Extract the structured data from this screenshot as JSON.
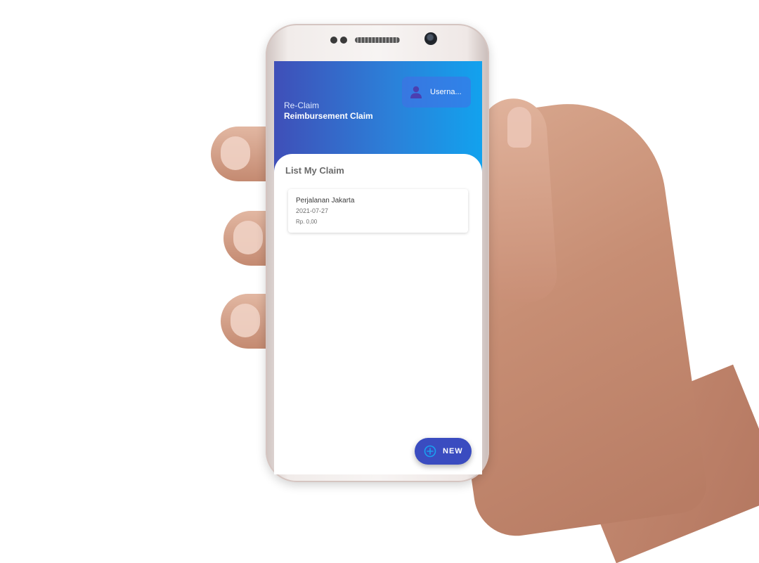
{
  "header": {
    "app_short_name": "Re-Claim",
    "app_full_name": "Reimbursement Claim",
    "user_label": "Userna..."
  },
  "list": {
    "title": "List My Claim",
    "claims": [
      {
        "title": "Perjalanan Jakarta",
        "date": "2021-07-27",
        "amount": "Rp. 0,00"
      }
    ]
  },
  "fab": {
    "label": "NEW",
    "icon": "plus-circle-icon"
  },
  "icons": {
    "user": "person-icon"
  },
  "colors": {
    "header_gradient_start": "#3f4fb8",
    "header_gradient_end": "#12a2ee",
    "accent": "#3a4cc0"
  }
}
